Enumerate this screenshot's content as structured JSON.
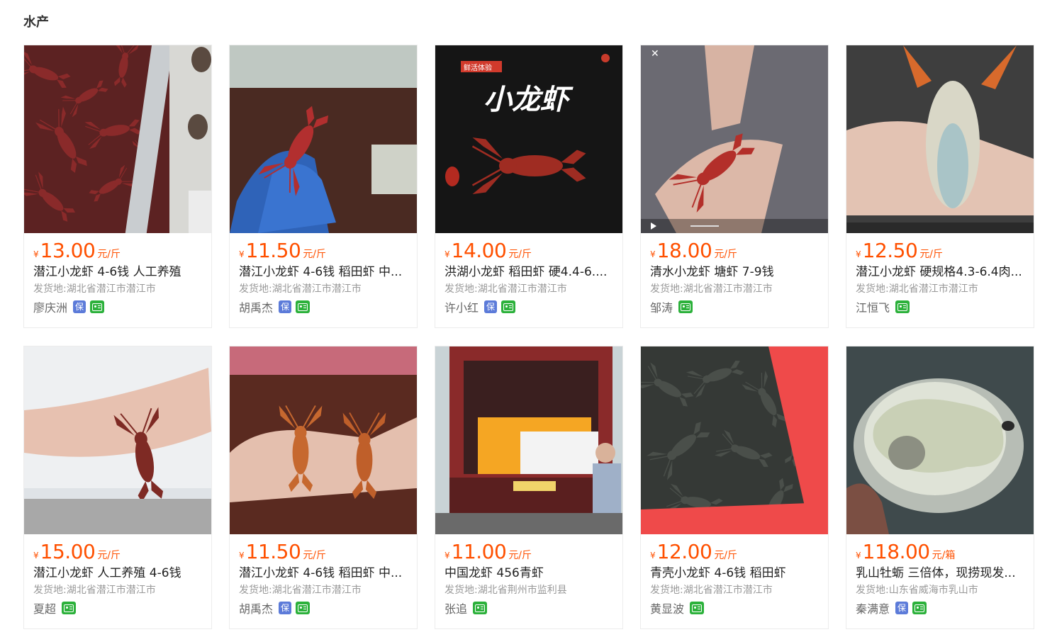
{
  "section": {
    "title": "水产"
  },
  "currency": "¥",
  "products": [
    {
      "price": "13.00",
      "unit": "元/斤",
      "title": "潜江小龙虾 4-6钱 人工养殖",
      "ship_label": "发货地:",
      "location": "湖北省潜江市潜江市",
      "seller": "廖庆洲",
      "bao": true,
      "id": true,
      "image": "crayfish-pile-photo"
    },
    {
      "price": "11.50",
      "unit": "元/斤",
      "title": "潜江小龙虾 4-6钱 稻田虾 中...",
      "ship_label": "发货地:",
      "location": "湖北省潜江市潜江市",
      "seller": "胡禹杰",
      "bao": true,
      "id": true,
      "image": "crayfish-in-glove-photo"
    },
    {
      "price": "14.00",
      "unit": "元/斤",
      "title": "洪湖小龙虾 稻田虾 硬4.4-6....",
      "ship_label": "发货地:",
      "location": "湖北省潜江市潜江市",
      "seller": "许小红",
      "bao": true,
      "id": true,
      "image": "crayfish-poster-photo",
      "overlay": {
        "tag": "鲜活体验",
        "headline": "小龙虾"
      }
    },
    {
      "price": "18.00",
      "unit": "元/斤",
      "title": "清水小龙虾 塘虾 7-9钱",
      "ship_label": "发货地:",
      "location": "湖北省潜江市潜江市",
      "seller": "邹涛",
      "bao": false,
      "id": true,
      "image": "crayfish-on-hand-video"
    },
    {
      "price": "12.50",
      "unit": "元/斤",
      "title": "潜江小龙虾 硬规格4.3-6.4肉...",
      "ship_label": "发货地:",
      "location": "湖北省潜江市潜江市",
      "seller": "江恒飞",
      "bao": false,
      "id": true,
      "image": "crayfish-underside-photo"
    },
    {
      "price": "15.00",
      "unit": "元/斤",
      "title": "潜江小龙虾 人工养殖 4-6钱",
      "ship_label": "发货地:",
      "location": "湖北省潜江市潜江市",
      "seller": "夏超",
      "bao": false,
      "id": true,
      "image": "crayfish-held-photo"
    },
    {
      "price": "11.50",
      "unit": "元/斤",
      "title": "潜江小龙虾 4-6钱 稻田虾 中...",
      "ship_label": "发货地:",
      "location": "湖北省潜江市潜江市",
      "seller": "胡禹杰",
      "bao": true,
      "id": true,
      "image": "two-crayfish-photo"
    },
    {
      "price": "11.00",
      "unit": "元/斤",
      "title": "中国龙虾 456青虾",
      "ship_label": "发货地:",
      "location": "湖北省荆州市监利县",
      "seller": "张追",
      "bao": false,
      "id": true,
      "image": "truck-boxes-photo"
    },
    {
      "price": "12.00",
      "unit": "元/斤",
      "title": "青壳小龙虾 4-6钱 稻田虾",
      "ship_label": "发货地:",
      "location": "湖北省潜江市潜江市",
      "seller": "黄显波",
      "bao": false,
      "id": true,
      "image": "crayfish-basket-photo"
    },
    {
      "price": "118.00",
      "unit": "元/箱",
      "title": "乳山牡蛎 三倍体，现捞现发...",
      "ship_label": "发货地:",
      "location": "山东省威海市乳山市",
      "seller": "秦满意",
      "bao": true,
      "id": true,
      "image": "oyster-photo"
    }
  ],
  "badges": {
    "bao_label": "保"
  },
  "colors": {
    "price": "#ff5000",
    "bao_badge": "#5c7bd9",
    "id_badge": "#2cb13b"
  }
}
